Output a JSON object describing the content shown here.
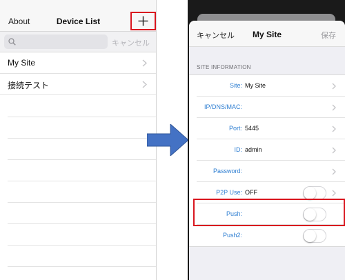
{
  "left": {
    "nav": {
      "about": "About",
      "title": "Device List"
    },
    "search": {
      "placeholder": "",
      "cancel": "キャンセル"
    },
    "devices": [
      {
        "label": "My Site"
      },
      {
        "label": "接続テスト"
      }
    ]
  },
  "right": {
    "nav": {
      "cancel": "キャンセル",
      "title": "My Site",
      "save": "保存"
    },
    "section_header": "SITE INFORMATION",
    "fields": [
      {
        "label": "Site:",
        "value": "My Site"
      },
      {
        "label": "IP/DNS/MAC:",
        "value": ""
      },
      {
        "label": "Port:",
        "value": "5445"
      },
      {
        "label": "ID:",
        "value": "admin"
      },
      {
        "label": "Password:",
        "value": ""
      },
      {
        "label": "P2P Use:",
        "value": "OFF"
      },
      {
        "label": "Push:",
        "value": ""
      },
      {
        "label": "Push2:",
        "value": ""
      }
    ]
  },
  "icons": {
    "add": "plus-icon",
    "search": "search-icon",
    "chevron": "chevron-right-icon",
    "arrow": "arrow-right-icon"
  },
  "colors": {
    "highlight": "#d9151e",
    "label_blue": "#2f7fd2",
    "arrow_blue": "#4472c4"
  }
}
